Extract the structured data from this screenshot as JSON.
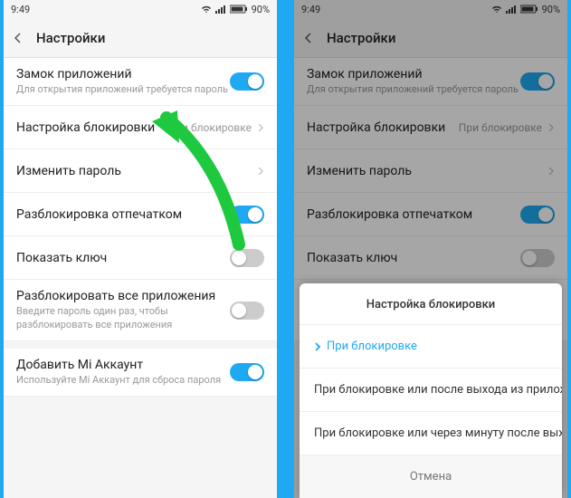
{
  "status": {
    "time": "9:49",
    "battery": "90%"
  },
  "header": {
    "title": "Настройки"
  },
  "rows": {
    "appLock": {
      "label": "Замок приложений",
      "sub": "Для открытия приложений требуется пароль"
    },
    "lockSetting": {
      "label": "Настройка блокировки",
      "value": "При блокировке"
    },
    "changePwd": {
      "label": "Изменить пароль"
    },
    "fingerprint": {
      "label": "Разблокировка отпечатком"
    },
    "showKey": {
      "label": "Показать ключ"
    },
    "unlockAll": {
      "label": "Разблокировать все приложения",
      "sub": "Введите пароль один раз, чтобы разблокировать все приложения"
    },
    "miAccount": {
      "label": "Добавить Mi Аккаунт",
      "sub": "Используйте Mi Аккаунт для сброса пароля"
    }
  },
  "sheet": {
    "title": "Настройка блокировки",
    "opt1": "При блокировке",
    "opt2": "При блокировке или после выхода из приложения",
    "opt3": "При блокировке или через минуту после выхода из прилож…",
    "cancel": "Отмена"
  }
}
